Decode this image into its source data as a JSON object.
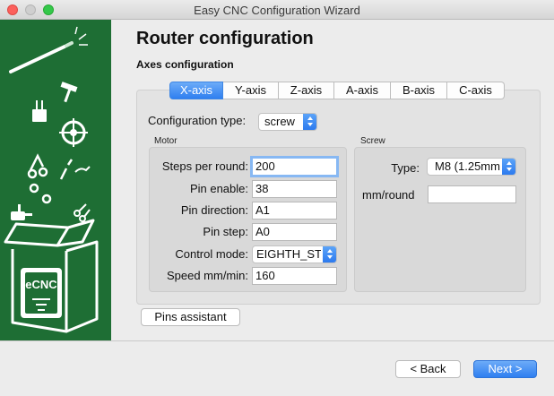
{
  "window": {
    "title": "Easy CNC Configuration Wizard"
  },
  "page": {
    "title": "Router configuration",
    "section": "Axes configuration"
  },
  "tabs": [
    {
      "label": "X-axis",
      "active": true
    },
    {
      "label": "Y-axis",
      "active": false
    },
    {
      "label": "Z-axis",
      "active": false
    },
    {
      "label": "A-axis",
      "active": false
    },
    {
      "label": "B-axis",
      "active": false
    },
    {
      "label": "C-axis",
      "active": false
    }
  ],
  "config_type": {
    "label": "Configuration type:",
    "value": "screw"
  },
  "motor": {
    "title": "Motor",
    "steps_label": "Steps per round:",
    "steps_value": "200",
    "pin_enable_label": "Pin enable:",
    "pin_enable_value": "38",
    "pin_direction_label": "Pin direction:",
    "pin_direction_value": "A1",
    "pin_step_label": "Pin step:",
    "pin_step_value": "A0",
    "control_mode_label": "Control mode:",
    "control_mode_value": "EIGHTH_ST",
    "speed_label": "Speed mm/min:",
    "speed_value": "160"
  },
  "screw": {
    "title": "Screw",
    "type_label": "Type:",
    "type_value": "M8 (1.25mm",
    "mm_round_label": "mm/round",
    "mm_round_value": ""
  },
  "buttons": {
    "pins_assistant": "Pins assistant",
    "back": "< Back",
    "next": "Next >"
  },
  "sidebar": {
    "logo_text": "eCNC"
  },
  "colors": {
    "sidebar_bg": "#1e6e34",
    "accent": "#2f7ff0"
  }
}
